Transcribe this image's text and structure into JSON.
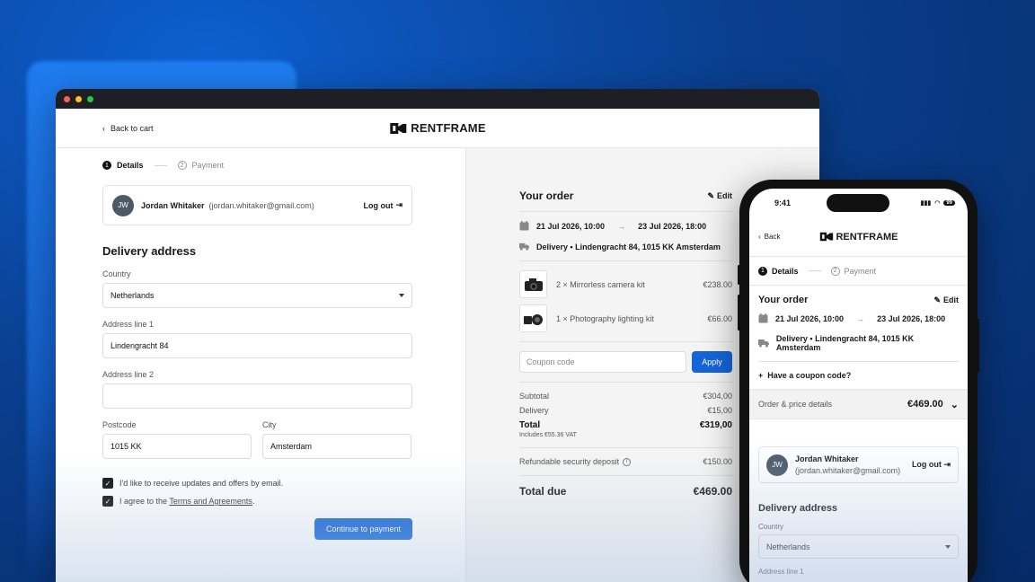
{
  "brand": {
    "name": "RENTFRAME"
  },
  "desktop": {
    "back_label": "Back to cart",
    "steps": [
      {
        "num": "1",
        "label": "Details"
      },
      {
        "num": "2",
        "label": "Payment"
      }
    ],
    "user": {
      "initials": "JW",
      "name": "Jordan Whitaker",
      "email": "(jordan.whitaker@gmail.com)",
      "logout": "Log out"
    },
    "delivery_title": "Delivery address",
    "fields": {
      "country_label": "Country",
      "country_value": "Netherlands",
      "address1_label": "Address line 1",
      "address1_value": "Lindengracht 84",
      "address2_label": "Address line 2",
      "address2_value": "",
      "postcode_label": "Postcode",
      "postcode_value": "1015 KK",
      "city_label": "City",
      "city_value": "Amsterdam"
    },
    "checks": {
      "updates": "I'd like to receive updates and offers by email.",
      "terms_prefix": "I agree to the ",
      "terms_link": "Terms and Agreements",
      "terms_suffix": "."
    },
    "continue_label": "Continue to payment"
  },
  "order": {
    "title": "Your order",
    "edit": "Edit",
    "start": "21 Jul 2026, 10:00",
    "end": "23 Jul 2026, 18:00",
    "delivery": "Delivery • Lindengracht 84, 1015 KK Amsterdam",
    "items": [
      {
        "name": "2 × Mirrorless camera kit",
        "price": "€238.00"
      },
      {
        "name": "1 × Photography lighting kit",
        "price": "€66.00"
      }
    ],
    "coupon_placeholder": "Coupon code",
    "apply": "Apply",
    "subtotal_label": "Subtotal",
    "subtotal": "€304,00",
    "delivery_label": "Delivery",
    "delivery_fee": "€15,00",
    "total_label": "Total",
    "total": "€319,00",
    "vat": "Includes €55.36 VAT",
    "deposit_label": "Refundable security deposit",
    "deposit": "€150.00",
    "due_label": "Total due",
    "due": "€469.00"
  },
  "mobile": {
    "time": "9:41",
    "battery": "99",
    "back_label": "Back",
    "coupon_link": "Have a coupon code?",
    "price_details": "Order & price details",
    "price_total": "€469.00",
    "email": "(jordan.whitaker@gmail.com)",
    "address1_label": "Address line 1"
  }
}
